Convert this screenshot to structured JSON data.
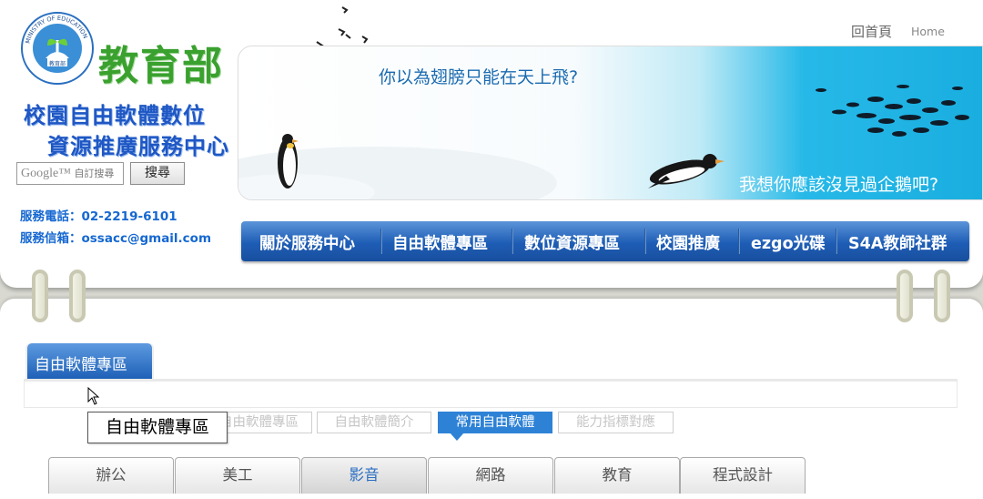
{
  "header": {
    "logo_text": "MINISTRY OF EDUCATION",
    "logo_inner_text": "教育部",
    "ministry_name": "教育部",
    "center_name_line1": "校園自由軟體數位",
    "center_name_line2": "資源推廣服務中心",
    "home_link_zh": "回首頁",
    "home_link_en": "Home"
  },
  "search": {
    "logo_text": "Google™",
    "placeholder": "自訂搜尋",
    "button_label": "搜尋"
  },
  "contact": {
    "phone": "服務電話：02-2219-6101",
    "email": "服務信箱：ossacc@gmail.com"
  },
  "banner": {
    "question": "你以為翅膀只能在天上飛?",
    "answer": "我想你應該沒見過企鵝吧?"
  },
  "nav": {
    "items": [
      {
        "label": "關於服務中心"
      },
      {
        "label": "自由軟體專區"
      },
      {
        "label": "數位資源專區"
      },
      {
        "label": "校園推廣"
      },
      {
        "label": "ezgo光碟"
      },
      {
        "label": "S4A教師社群"
      }
    ]
  },
  "section": {
    "tab_label": "自由軟體專區",
    "subtabs": [
      {
        "label": "自由軟體專區"
      },
      {
        "label": "自由軟體簡介"
      },
      {
        "label": "常用自由軟體"
      },
      {
        "label": "能力指標對應"
      }
    ],
    "tooltip": "自由軟體專區",
    "categories": [
      {
        "label": "辦公"
      },
      {
        "label": "美工"
      },
      {
        "label": "影音"
      },
      {
        "label": "網路"
      },
      {
        "label": "教育"
      },
      {
        "label": "程式設計"
      }
    ]
  },
  "colors": {
    "brand_blue": "#1e5db6",
    "brand_green": "#3aa12f",
    "active_subtab": "#2e82d6"
  }
}
